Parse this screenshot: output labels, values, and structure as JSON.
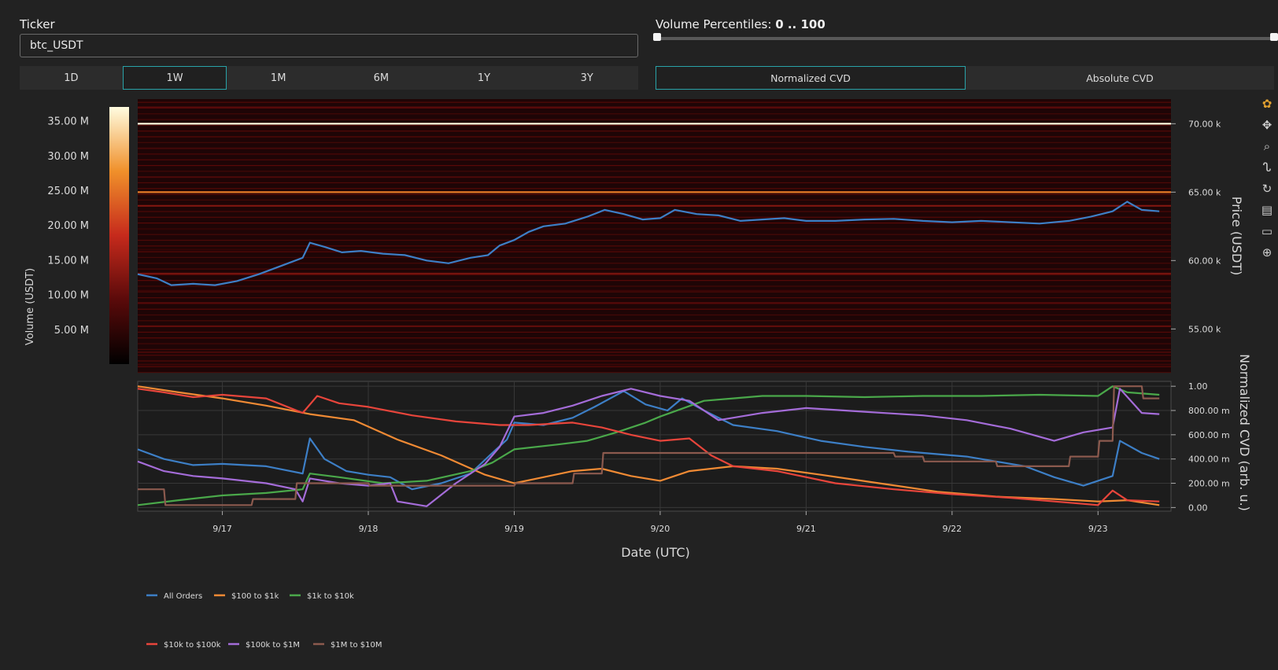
{
  "controls": {
    "ticker_label": "Ticker",
    "ticker_value": "btc_USDT",
    "volume_label": "Volume Percentiles: ",
    "volume_range": "0 .. 100",
    "timeframes": [
      "1D",
      "1W",
      "1M",
      "6M",
      "1Y",
      "3Y"
    ],
    "timeframe_active": "1W",
    "cvd_modes": [
      "Normalized CVD",
      "Absolute CVD"
    ],
    "cvd_active": "Normalized CVD"
  },
  "colors": {
    "background": "#222222",
    "plot_bg": "#1a1a1a",
    "accent": "#29a3a8",
    "price_line": "#3d7fc6"
  },
  "chart_data": [
    {
      "type": "heatmap",
      "colorbar_title": "Volume (USDT)",
      "colorbar_ticks": [
        "5.00 M",
        "10.00 M",
        "15.00 M",
        "20.00 M",
        "25.00 M",
        "30.00 M",
        "35.00 M"
      ],
      "colorbar_values": [
        5,
        10,
        15,
        20,
        25,
        30,
        35
      ],
      "colorbar_range": [
        0,
        37
      ],
      "ylabel": "Price (USDT)",
      "y_ticks": [
        "55.00 k",
        "60.00 k",
        "65.00 k",
        "70.00 k"
      ],
      "y_tick_values": [
        55000,
        60000,
        65000,
        70000
      ],
      "ylim": [
        51800,
        71800
      ],
      "xlim": [
        16.42,
        23.5
      ],
      "heat_levels": [
        {
          "price": 70000,
          "volume": 37
        },
        {
          "price": 65000,
          "volume": 26
        },
        {
          "price": 64000,
          "volume": 13
        },
        {
          "price": 59050,
          "volume": 12
        },
        {
          "price": 56900,
          "volume": 9
        },
        {
          "price": 55200,
          "volume": 10
        },
        {
          "price": 71200,
          "volume": 9
        },
        {
          "price": 68200,
          "volume": 7
        },
        {
          "price": 66100,
          "volume": 8
        },
        {
          "price": 57800,
          "volume": 6
        },
        {
          "price": 53300,
          "volume": 7
        },
        {
          "price": 52400,
          "volume": 6
        },
        {
          "price": 62300,
          "volume": 5
        },
        {
          "price": 60800,
          "volume": 5
        }
      ],
      "price_series": {
        "name": "Price",
        "x": [
          16.42,
          16.55,
          16.65,
          16.8,
          16.95,
          17.1,
          17.25,
          17.4,
          17.55,
          17.6,
          17.7,
          17.82,
          17.95,
          18.1,
          18.25,
          18.4,
          18.55,
          18.7,
          18.82,
          18.9,
          19.0,
          19.1,
          19.2,
          19.35,
          19.5,
          19.62,
          19.75,
          19.88,
          20.0,
          20.1,
          20.25,
          20.4,
          20.55,
          20.7,
          20.85,
          21.0,
          21.2,
          21.4,
          21.6,
          21.8,
          22.0,
          22.2,
          22.4,
          22.6,
          22.8,
          22.95,
          23.1,
          23.2,
          23.3,
          23.42
        ],
        "y": [
          59000,
          58700,
          58200,
          58300,
          58200,
          58500,
          59000,
          59600,
          60200,
          61300,
          61000,
          60600,
          60700,
          60500,
          60400,
          60000,
          59800,
          60200,
          60400,
          61100,
          61500,
          62100,
          62500,
          62700,
          63200,
          63700,
          63400,
          63000,
          63100,
          63700,
          63400,
          63300,
          62900,
          63000,
          63100,
          62900,
          62900,
          63000,
          63050,
          62900,
          62800,
          62900,
          62800,
          62700,
          62900,
          63200,
          63600,
          64300,
          63700,
          63600
        ]
      }
    },
    {
      "type": "line",
      "xlabel": "Date (UTC)",
      "ylabel": "Normalized CVD (arb. u.)",
      "x_ticks": [
        "9/17",
        "9/18",
        "9/19",
        "9/20",
        "9/21",
        "9/22",
        "9/23"
      ],
      "x_tick_values": [
        17,
        18,
        19,
        20,
        21,
        22,
        23
      ],
      "y_ticks": [
        "0.00",
        "200.00 m",
        "400.00 m",
        "600.00 m",
        "800.00 m",
        "1.00"
      ],
      "y_tick_values": [
        0,
        0.2,
        0.4,
        0.6,
        0.8,
        1.0
      ],
      "ylim": [
        -0.03,
        1.04
      ],
      "xlim": [
        16.42,
        23.5
      ],
      "legend_position": "bottom-left",
      "series": [
        {
          "name": "All Orders",
          "color": "#3d7fc6",
          "x": [
            16.42,
            16.6,
            16.8,
            17.0,
            17.3,
            17.55,
            17.6,
            17.7,
            17.85,
            18.0,
            18.15,
            18.3,
            18.5,
            18.7,
            18.85,
            18.95,
            19.0,
            19.2,
            19.4,
            19.55,
            19.75,
            19.9,
            20.05,
            20.15,
            20.3,
            20.5,
            20.8,
            21.1,
            21.4,
            21.7,
            21.9,
            22.1,
            22.3,
            22.5,
            22.7,
            22.9,
            23.0,
            23.1,
            23.15,
            23.3,
            23.42
          ],
          "y": [
            0.48,
            0.4,
            0.35,
            0.36,
            0.34,
            0.28,
            0.57,
            0.4,
            0.3,
            0.27,
            0.25,
            0.15,
            0.2,
            0.28,
            0.45,
            0.56,
            0.7,
            0.68,
            0.74,
            0.83,
            0.96,
            0.85,
            0.8,
            0.9,
            0.8,
            0.68,
            0.63,
            0.55,
            0.5,
            0.46,
            0.44,
            0.42,
            0.38,
            0.34,
            0.25,
            0.18,
            0.22,
            0.26,
            0.55,
            0.45,
            0.4
          ]
        },
        {
          "name": "$100 to $1k",
          "color": "#f08a34",
          "x": [
            16.42,
            16.7,
            17.0,
            17.3,
            17.6,
            17.9,
            18.2,
            18.5,
            18.8,
            19.0,
            19.2,
            19.4,
            19.6,
            19.8,
            20.0,
            20.2,
            20.5,
            20.8,
            21.1,
            21.5,
            21.9,
            22.3,
            22.7,
            23.0,
            23.2,
            23.42
          ],
          "y": [
            1.0,
            0.95,
            0.9,
            0.84,
            0.77,
            0.72,
            0.56,
            0.43,
            0.27,
            0.2,
            0.25,
            0.3,
            0.32,
            0.26,
            0.22,
            0.3,
            0.34,
            0.32,
            0.27,
            0.2,
            0.13,
            0.09,
            0.07,
            0.05,
            0.06,
            0.02
          ]
        },
        {
          "name": "$1k to $10k",
          "color": "#4aa84a",
          "x": [
            16.42,
            16.7,
            17.0,
            17.3,
            17.55,
            17.6,
            17.8,
            18.1,
            18.4,
            18.7,
            18.85,
            19.0,
            19.3,
            19.5,
            19.7,
            19.9,
            20.0,
            20.3,
            20.5,
            20.7,
            21.0,
            21.4,
            21.8,
            22.2,
            22.6,
            23.0,
            23.1,
            23.2,
            23.42
          ],
          "y": [
            0.02,
            0.06,
            0.1,
            0.12,
            0.15,
            0.28,
            0.25,
            0.2,
            0.22,
            0.3,
            0.37,
            0.48,
            0.52,
            0.55,
            0.62,
            0.7,
            0.75,
            0.88,
            0.9,
            0.92,
            0.92,
            0.91,
            0.92,
            0.92,
            0.93,
            0.92,
            1.0,
            0.95,
            0.93
          ]
        },
        {
          "name": "$10k to $100k",
          "color": "#e8453b",
          "x": [
            16.42,
            16.6,
            16.8,
            17.0,
            17.3,
            17.55,
            17.65,
            17.8,
            18.0,
            18.3,
            18.6,
            18.9,
            19.1,
            19.4,
            19.6,
            19.8,
            20.0,
            20.2,
            20.35,
            20.5,
            20.8,
            21.2,
            21.6,
            22.0,
            22.4,
            22.8,
            23.0,
            23.1,
            23.2,
            23.42
          ],
          "y": [
            0.98,
            0.95,
            0.91,
            0.93,
            0.9,
            0.78,
            0.92,
            0.86,
            0.83,
            0.76,
            0.71,
            0.68,
            0.68,
            0.7,
            0.66,
            0.6,
            0.55,
            0.57,
            0.43,
            0.34,
            0.3,
            0.2,
            0.15,
            0.11,
            0.08,
            0.04,
            0.02,
            0.14,
            0.06,
            0.05
          ]
        },
        {
          "name": "$100k to $1M",
          "color": "#a46cd8",
          "x": [
            16.42,
            16.6,
            16.8,
            17.0,
            17.3,
            17.5,
            17.55,
            17.6,
            17.8,
            18.0,
            18.15,
            18.2,
            18.4,
            18.6,
            18.8,
            18.9,
            19.0,
            19.2,
            19.4,
            19.6,
            19.8,
            20.0,
            20.2,
            20.4,
            20.7,
            21.0,
            21.4,
            21.8,
            22.1,
            22.4,
            22.7,
            22.9,
            23.1,
            23.15,
            23.3,
            23.42
          ],
          "y": [
            0.38,
            0.3,
            0.26,
            0.24,
            0.2,
            0.15,
            0.05,
            0.24,
            0.2,
            0.18,
            0.2,
            0.05,
            0.01,
            0.2,
            0.36,
            0.5,
            0.75,
            0.78,
            0.84,
            0.92,
            0.98,
            0.92,
            0.88,
            0.72,
            0.78,
            0.82,
            0.79,
            0.76,
            0.72,
            0.65,
            0.55,
            0.62,
            0.66,
            0.98,
            0.78,
            0.77
          ]
        },
        {
          "name": "$1M to $10M",
          "color": "#8c5a4e",
          "x": [
            16.42,
            16.6,
            16.61,
            17.2,
            17.21,
            17.5,
            17.51,
            18.0,
            18.01,
            18.5,
            18.51,
            19.0,
            19.01,
            19.4,
            19.41,
            19.6,
            19.61,
            20.0,
            20.01,
            21.6,
            21.61,
            21.8,
            21.81,
            22.3,
            22.31,
            22.8,
            22.81,
            23.0,
            23.01,
            23.1,
            23.11,
            23.3,
            23.31,
            23.42
          ],
          "y": [
            0.15,
            0.15,
            0.02,
            0.02,
            0.07,
            0.07,
            0.2,
            0.2,
            0.18,
            0.18,
            0.18,
            0.18,
            0.2,
            0.2,
            0.28,
            0.28,
            0.45,
            0.45,
            0.45,
            0.45,
            0.42,
            0.42,
            0.38,
            0.38,
            0.34,
            0.34,
            0.42,
            0.42,
            0.55,
            0.55,
            1.0,
            1.0,
            0.9,
            0.9
          ]
        }
      ]
    }
  ]
}
